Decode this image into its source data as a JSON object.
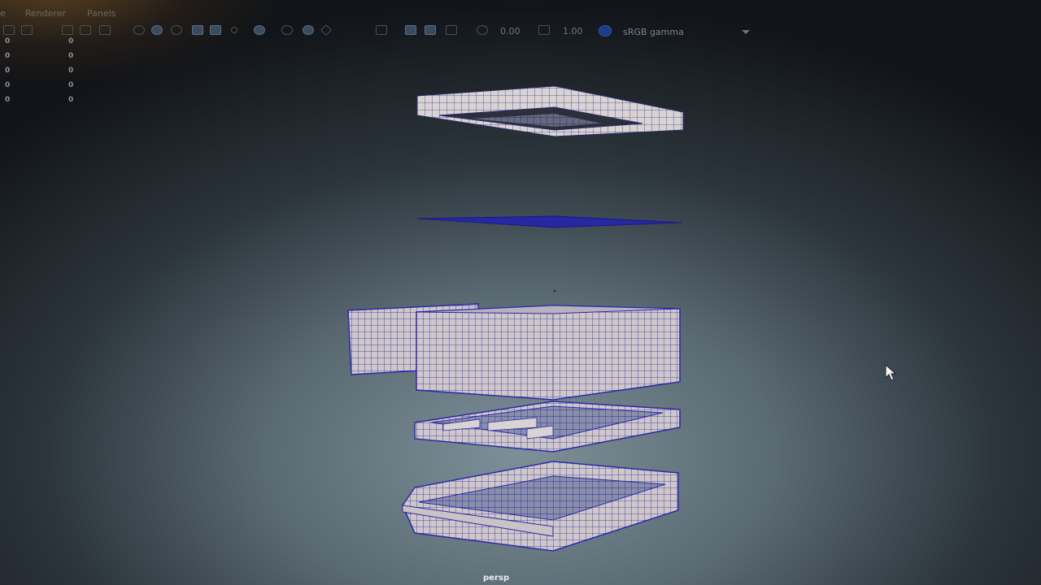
{
  "menu": {
    "items": [
      {
        "label": "Renderer"
      },
      {
        "label": "Panels"
      }
    ]
  },
  "toolbar": {
    "exposure_value": "0.00",
    "gamma_value": "1.00",
    "color_space": "sRGB gamma"
  },
  "hud": {
    "rows": [
      {
        "a": "0",
        "b": "0"
      },
      {
        "a": "0",
        "b": "0"
      },
      {
        "a": "0",
        "b": "0"
      },
      {
        "a": "0",
        "b": "0"
      },
      {
        "a": "0",
        "b": "0"
      }
    ]
  },
  "viewport": {
    "camera_label": "persp"
  },
  "colors": {
    "mesh_face": "#d9d3d4",
    "mesh_wire": "#2a2aa8",
    "background_center": "#7d8f98",
    "background_edge": "#111418"
  }
}
